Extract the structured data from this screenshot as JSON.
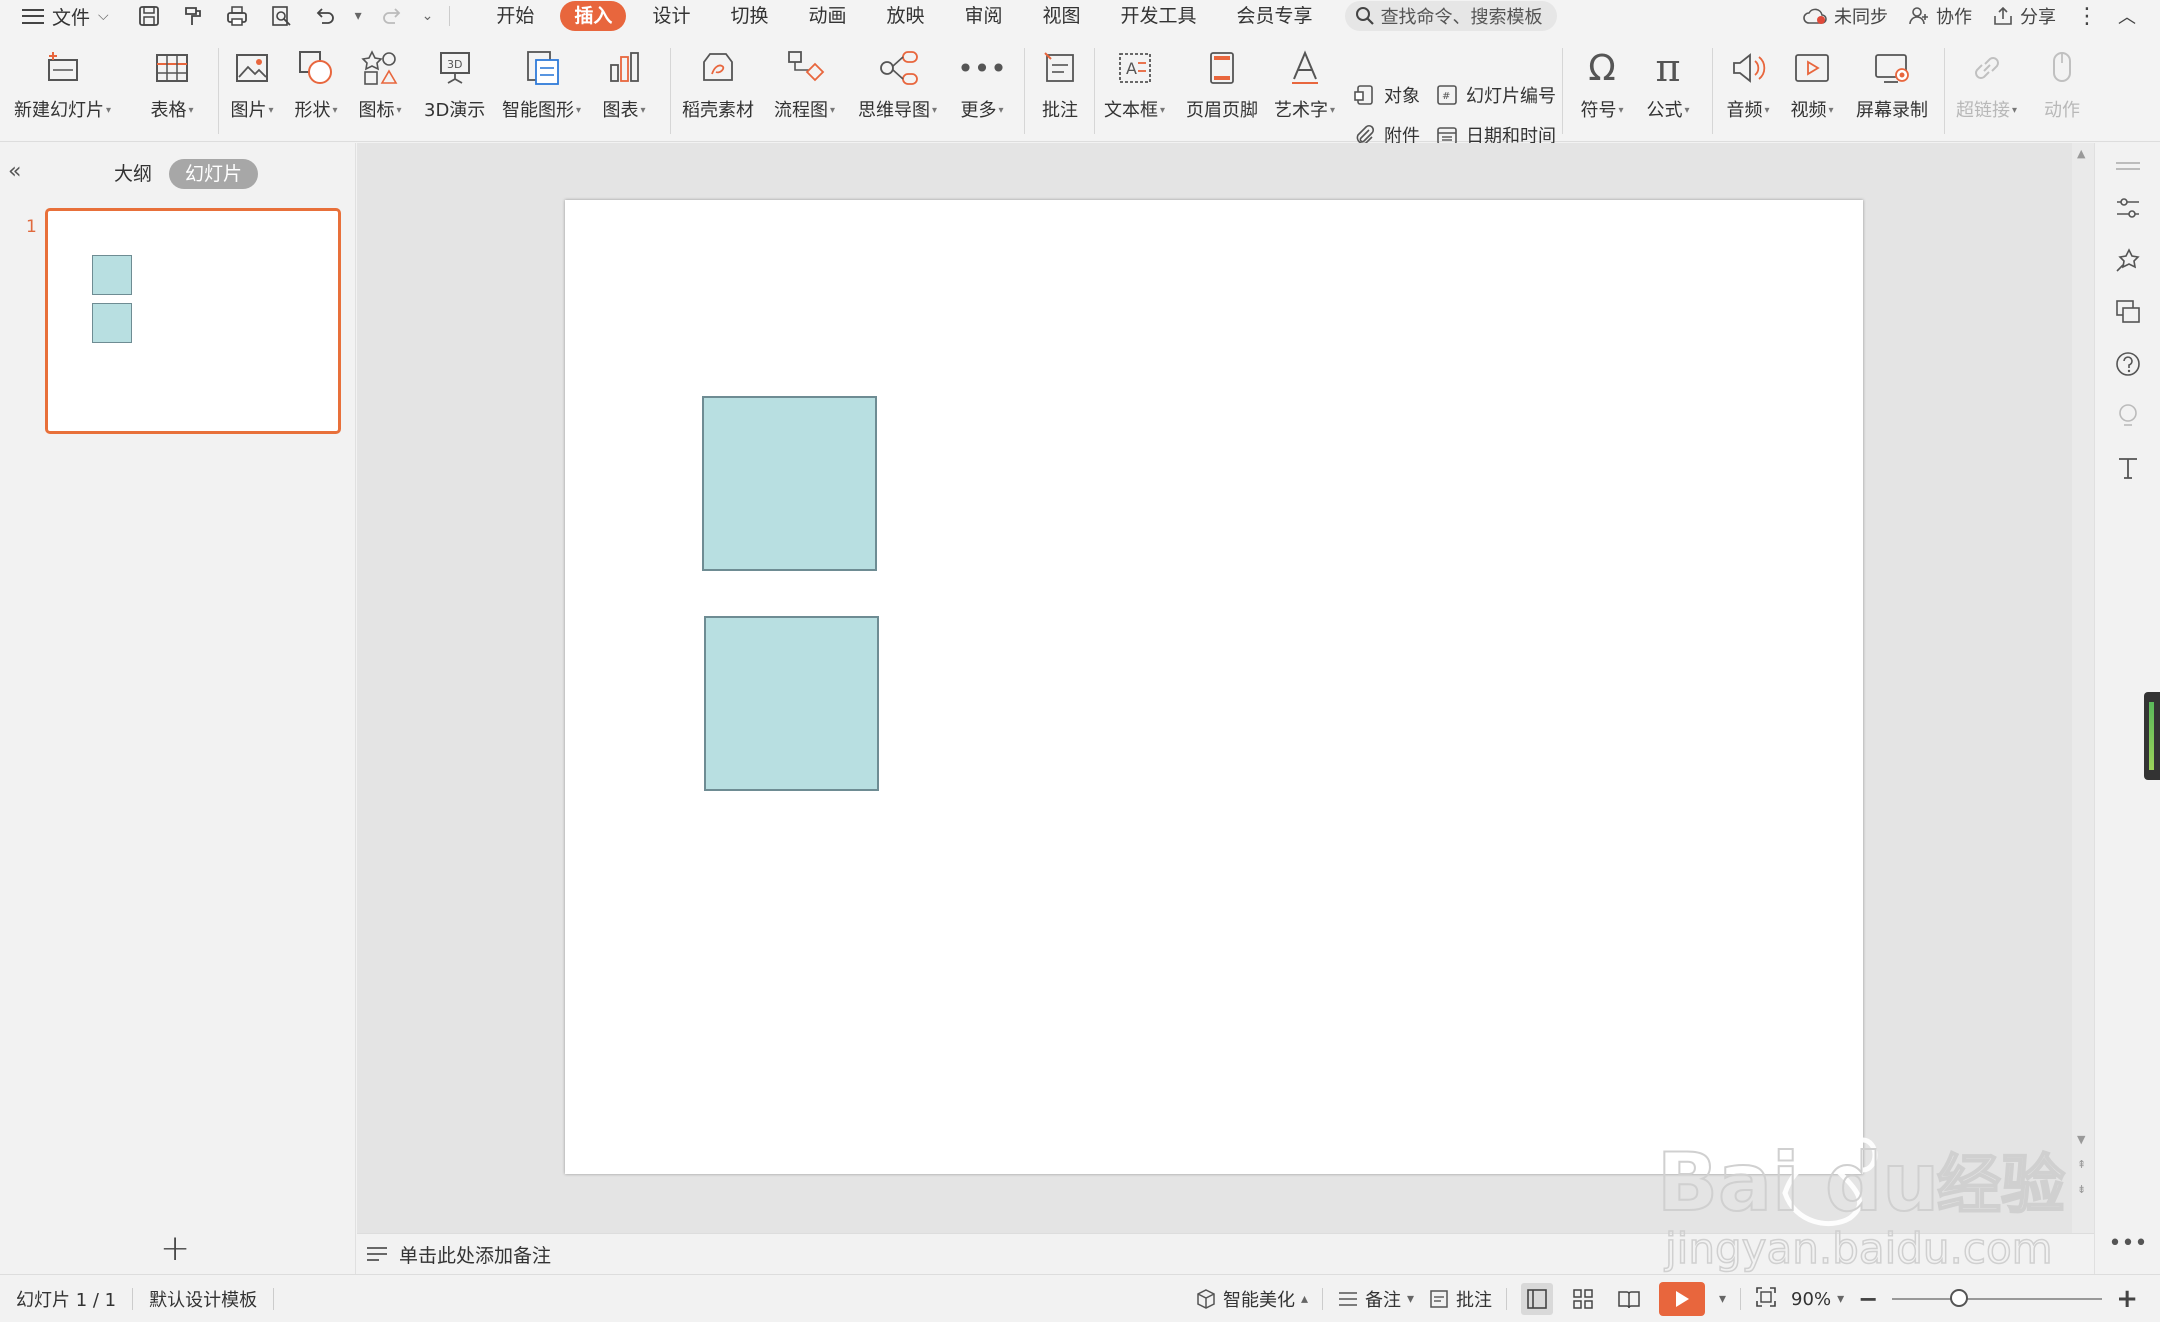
{
  "menubar": {
    "file_label": "文件",
    "tabs": [
      "开始",
      "插入",
      "设计",
      "切换",
      "动画",
      "放映",
      "审阅",
      "视图",
      "开发工具",
      "会员专享"
    ],
    "active_tab": "插入",
    "search_placeholder": "查找命令、搜索模板",
    "sync_label": "未同步",
    "collab_label": "协作",
    "share_label": "分享"
  },
  "ribbon": {
    "new_slide": "新建幻灯片",
    "table": "表格",
    "picture": "图片",
    "shape": "形状",
    "icon": "图标",
    "demo3d": "3D演示",
    "smartart": "智能图形",
    "chart": "图表",
    "daoke": "稻壳素材",
    "flowchart": "流程图",
    "mindmap": "思维导图",
    "more": "更多",
    "comment": "批注",
    "textbox": "文本框",
    "header_footer": "页眉页脚",
    "wordart": "艺术字",
    "object": "对象",
    "slide_number": "幻灯片编号",
    "attachment": "附件",
    "datetime": "日期和时间",
    "symbol": "符号",
    "formula": "公式",
    "audio": "音频",
    "video": "视频",
    "screen_record": "屏幕录制",
    "hyperlink": "超链接",
    "action": "动作"
  },
  "panel": {
    "outline_tab": "大纲",
    "slides_tab": "幻灯片",
    "slide_number": "1"
  },
  "notes": {
    "placeholder": "单击此处添加备注"
  },
  "statusbar": {
    "slide_info": "幻灯片 1 / 1",
    "template": "默认设计模板",
    "beautify": "智能美化",
    "notes": "备注",
    "comments": "批注",
    "zoom": "90%",
    "zoom_fraction": 0.32
  },
  "colors": {
    "accent": "#e8663d",
    "shape_fill": "#b8dfe1",
    "shape_border": "#6e8c93"
  },
  "watermark": {
    "brand": "Bai",
    "brand2": "du",
    "cn": "经验",
    "url": "jingyan.baidu.com"
  }
}
